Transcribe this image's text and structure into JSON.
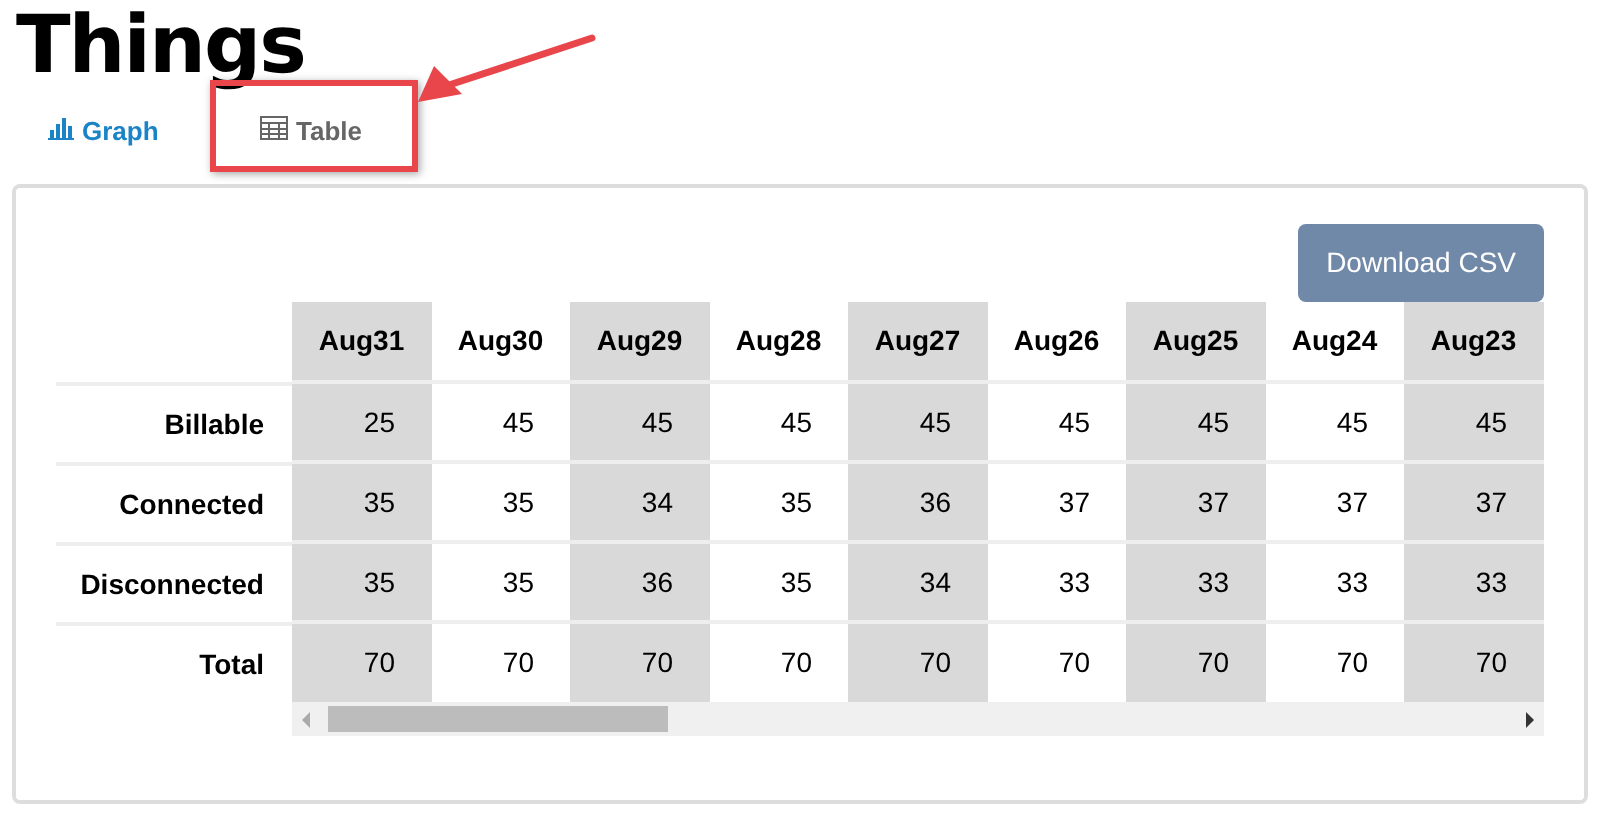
{
  "title": "Things",
  "tabs": [
    {
      "label": "Graph",
      "kind": "graph",
      "selected": false,
      "highlighted": false
    },
    {
      "label": "Table",
      "kind": "table",
      "selected": true,
      "highlighted": true
    }
  ],
  "download_button": "Download CSV",
  "table": {
    "columns": [
      "Aug31",
      "Aug30",
      "Aug29",
      "Aug28",
      "Aug27",
      "Aug26",
      "Aug25",
      "Aug24",
      "Aug23"
    ],
    "rows": [
      {
        "label": "Billable",
        "values": [
          "25",
          "45",
          "45",
          "45",
          "45",
          "45",
          "45",
          "45",
          "45"
        ]
      },
      {
        "label": "Connected",
        "values": [
          "35",
          "35",
          "34",
          "35",
          "36",
          "37",
          "37",
          "37",
          "37"
        ]
      },
      {
        "label": "Disconnected",
        "values": [
          "35",
          "35",
          "36",
          "35",
          "34",
          "33",
          "33",
          "33",
          "33"
        ]
      },
      {
        "label": "Total",
        "values": [
          "70",
          "70",
          "70",
          "70",
          "70",
          "70",
          "70",
          "70",
          "70"
        ]
      }
    ]
  }
}
